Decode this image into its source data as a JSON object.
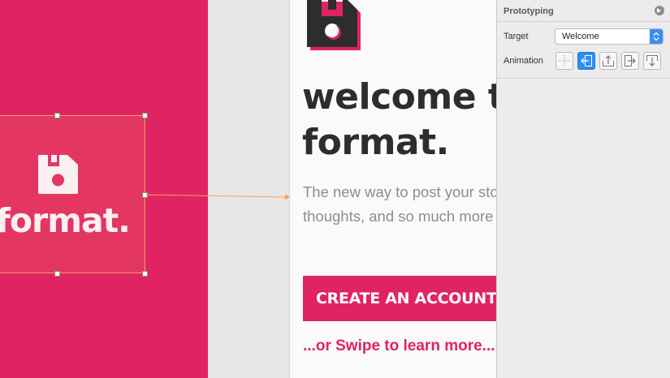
{
  "left_artboard": {
    "brand_text": "format.",
    "logo_icon": "floppy-disk-icon"
  },
  "welcome_artboard": {
    "logo_icon": "floppy-disk-icon",
    "title_line1": "welcome t",
    "title_line2": "format.",
    "description_line1": "The new way to post your sto",
    "description_line2": "thoughts, and so much more",
    "cta_label": "CREATE AN ACCOUNT",
    "swipe_link": "...or Swipe to learn more..."
  },
  "inspector": {
    "section_title": "Prototyping",
    "target_label": "Target",
    "target_value": "Welcome",
    "animation_label": "Animation",
    "animation_options": [
      "none",
      "slide-from-right",
      "slide-from-bottom",
      "slide-from-left",
      "slide-from-top"
    ],
    "animation_selected": "slide-from-right"
  },
  "colors": {
    "brand_pink": "#e02363",
    "selection_orange": "#f5a15a",
    "accent_blue": "#2b8ff2"
  }
}
